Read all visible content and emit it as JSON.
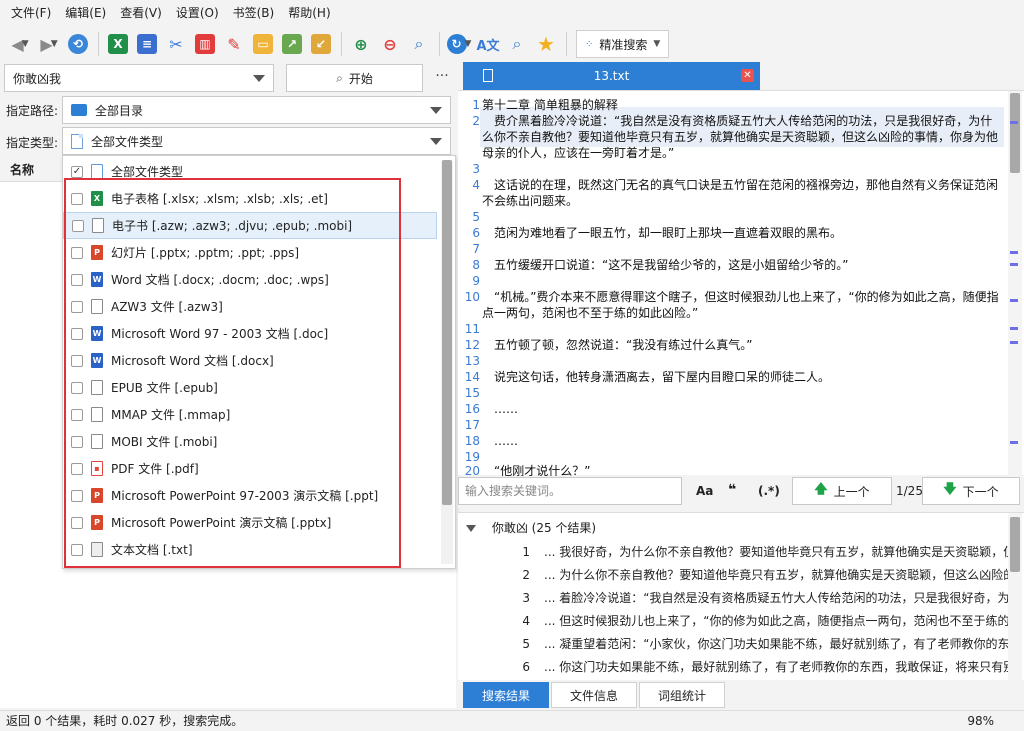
{
  "menu": [
    "文件(F)",
    "编辑(E)",
    "查看(V)",
    "设置(O)",
    "书签(B)",
    "帮助(H)"
  ],
  "toolbar": {
    "precise_search_label": "精准搜索",
    "icons": [
      "back-icon",
      "forward-icon",
      "history-icon",
      "excel-icon",
      "document-icon",
      "cut-icon",
      "delete-icon",
      "clean-icon",
      "open-folder-icon",
      "export-icon",
      "import-icon",
      "zoom-in-icon",
      "zoom-out-icon",
      "search-icon",
      "refresh-icon",
      "translate-icon",
      "find-icon",
      "star-icon"
    ]
  },
  "search": {
    "query": "你敢凶我",
    "start_label": "开始",
    "more": "···"
  },
  "filters": {
    "path_label": "指定路径:",
    "path_value": "全部目录",
    "type_label": "指定类型:",
    "type_value": "全部文件类型"
  },
  "list": {
    "header_name": "名称"
  },
  "file_types": [
    {
      "label": "全部文件类型",
      "checked": true,
      "icon": "doc-icon"
    },
    {
      "label": "电子表格 [.xlsx; .xlsm; .xlsb; .xls; .et]",
      "checked": false,
      "icon": "excel-icon"
    },
    {
      "label": "电子书 [.azw; .azw3; .djvu; .epub; .mobi]",
      "checked": false,
      "icon": "ebook-icon"
    },
    {
      "label": "幻灯片 [.pptx; .pptm; .ppt; .pps]",
      "checked": false,
      "icon": "powerpoint-icon"
    },
    {
      "label": "Word 文档 [.docx; .docm; .doc; .wps]",
      "checked": false,
      "icon": "word-icon"
    },
    {
      "label": "AZW3 文件 [.azw3]",
      "checked": false,
      "icon": "file-icon"
    },
    {
      "label": "Microsoft Word 97 - 2003 文档 [.doc]",
      "checked": false,
      "icon": "word-icon"
    },
    {
      "label": "Microsoft Word 文档 [.docx]",
      "checked": false,
      "icon": "word-icon"
    },
    {
      "label": "EPUB 文件 [.epub]",
      "checked": false,
      "icon": "file-icon"
    },
    {
      "label": "MMAP 文件 [.mmap]",
      "checked": false,
      "icon": "file-icon"
    },
    {
      "label": "MOBI 文件 [.mobi]",
      "checked": false,
      "icon": "file-icon"
    },
    {
      "label": "PDF 文件 [.pdf]",
      "checked": false,
      "icon": "pdf-icon"
    },
    {
      "label": "Microsoft PowerPoint 97-2003 演示文稿 [.ppt]",
      "checked": false,
      "icon": "powerpoint-icon"
    },
    {
      "label": "Microsoft PowerPoint 演示文稿 [.pptx]",
      "checked": false,
      "icon": "powerpoint-icon"
    },
    {
      "label": "文本文档 [.txt]",
      "checked": false,
      "icon": "text-file-icon"
    }
  ],
  "editor": {
    "tab_title": "13.txt",
    "lines": [
      {
        "n": "1",
        "t": "第十二章 简单粗暴的解释"
      },
      {
        "n": "2",
        "t": "　费介黑着脸冷冷说道：“我自然是没有资格质疑五竹大人传给范闲的功法，只是我很好奇，为什么你不亲自教他？要知道他毕竟只有五岁，就算他确实是天资聪颖，但这么凶险的事情，你身为他母亲的仆人，应该在一旁盯着才是。”"
      },
      {
        "n": "3",
        "t": ""
      },
      {
        "n": "4",
        "t": "　这话说的在理，既然这门无名的真气口诀是五竹留在范闲的襁褓旁边，那他自然有义务保证范闲不会练出问题来。"
      },
      {
        "n": "5",
        "t": ""
      },
      {
        "n": "6",
        "t": "　范闲为难地看了一眼五竹，却一眼盯上那块一直遮着双眼的黑布。"
      },
      {
        "n": "7",
        "t": ""
      },
      {
        "n": "8",
        "t": "　五竹缓缓开口说道：“这不是我留给少爷的，这是小姐留给少爷的。”"
      },
      {
        "n": "9",
        "t": ""
      },
      {
        "n": "10",
        "t": "　“机械。”费介本来不愿意得罪这个瞎子，但这时候狠劲儿也上来了，“你的修为如此之高，随便指点一两句，范闲也不至于练的如此凶险。”"
      },
      {
        "n": "11",
        "t": ""
      },
      {
        "n": "12",
        "t": "　五竹顿了顿，忽然说道：“我没有练过什么真气。”"
      },
      {
        "n": "13",
        "t": ""
      },
      {
        "n": "14",
        "t": "　说完这句话，他转身潇洒离去，留下屋内目瞪口呆的师徒二人。"
      },
      {
        "n": "15",
        "t": ""
      },
      {
        "n": "16",
        "t": "　……"
      },
      {
        "n": "17",
        "t": ""
      },
      {
        "n": "18",
        "t": "　……"
      },
      {
        "n": "19",
        "t": ""
      },
      {
        "n": "20",
        "t": "　“他刚才说什么？”"
      }
    ]
  },
  "searchbar": {
    "placeholder": "输入搜索关键词。",
    "opt_case": "Aa",
    "opt_quote": "❝",
    "opt_regex": "(.*)",
    "prev_label": "上一个",
    "count": "1/25",
    "next_label": "下一个"
  },
  "results": {
    "header": "你敢凶 (25 个结果)",
    "rows": [
      {
        "n": "1",
        "t": "... 我很好奇，为什么你不亲自教他？要知道他毕竟只有五岁，就算他确实是天资聪颖，但这么..."
      },
      {
        "n": "2",
        "t": "... 为什么你不亲自教他？要知道他毕竟只有五岁，就算他确实是天资聪颖，但这么凶险的事..."
      },
      {
        "n": "3",
        "t": "... 着脸冷冷说道：“我自然是没有资格质疑五竹大人传给范闲的功法，只是我很好奇，为什..."
      },
      {
        "n": "4",
        "t": "... 但这时候狠劲儿也上来了，“你的修为如此之高，随便指点一两句，范闲也不至于练的如..."
      },
      {
        "n": "5",
        "t": "... 凝重望着范闲：“小家伙，你这门功夫如果能不练，最好就别练了，有了老师教你的东西..."
      },
      {
        "n": "6",
        "t": "... 你这门功夫如果能不练，最好就别练了，有了老师教你的东西，我敢保证，将来只有别人..."
      }
    ]
  },
  "bottom_tabs": [
    "搜索结果",
    "文件信息",
    "词组统计"
  ],
  "status": {
    "text": "返回 0 个结果，耗时 0.027 秒，搜索完成。",
    "zoom": "98%"
  }
}
